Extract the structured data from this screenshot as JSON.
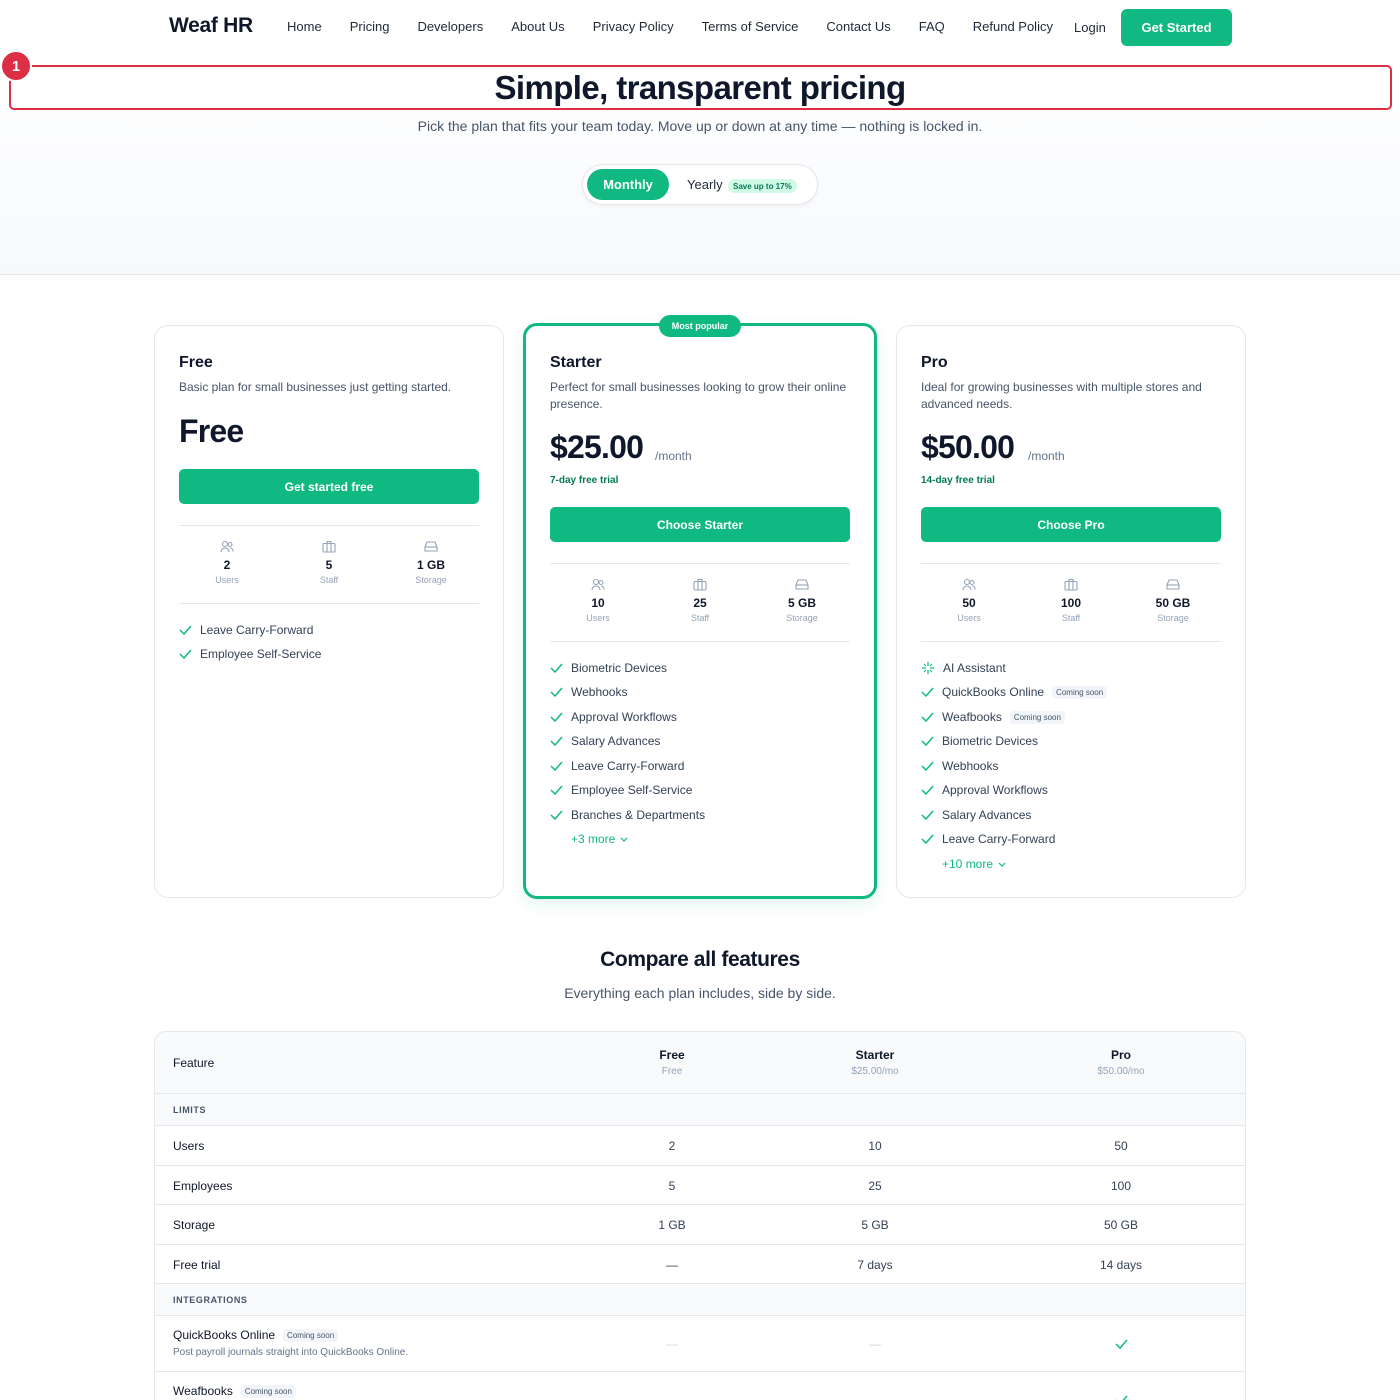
{
  "nav": {
    "logo": "Weaf HR",
    "links": [
      "Home",
      "Pricing",
      "Developers",
      "About Us",
      "Privacy Policy",
      "Terms of Service",
      "Contact Us",
      "FAQ",
      "Refund Policy"
    ],
    "login": "Login",
    "cta": "Get Started"
  },
  "annotation": {
    "badge": "1"
  },
  "hero": {
    "title": "Simple, transparent pricing",
    "subtitle": "Pick the plan that fits your team today. Move up or down at any time — nothing is locked in.",
    "toggle_monthly": "Monthly",
    "toggle_yearly": "Yearly",
    "save_badge": "Save up to 17%"
  },
  "popular_badge": "Most popular",
  "plans": [
    {
      "name": "Free",
      "desc": "Basic plan for small businesses just getting started.",
      "price": "Free",
      "button": "Get started free",
      "stats": [
        {
          "value": "2",
          "label": "Users"
        },
        {
          "value": "5",
          "label": "Staff"
        },
        {
          "value": "1 GB",
          "label": "Storage"
        }
      ],
      "features": [
        "Leave Carry-Forward",
        "Employee Self-Service"
      ]
    },
    {
      "name": "Starter",
      "desc": "Perfect for small businesses looking to grow their online presence.",
      "price": "$25.00",
      "per": "/month",
      "trial": "7-day free trial",
      "button": "Choose Starter",
      "stats": [
        {
          "value": "10",
          "label": "Users"
        },
        {
          "value": "25",
          "label": "Staff"
        },
        {
          "value": "5 GB",
          "label": "Storage"
        }
      ],
      "features": [
        "Biometric Devices",
        "Webhooks",
        "Approval Workflows",
        "Salary Advances",
        "Leave Carry-Forward",
        "Employee Self-Service",
        "Branches & Departments"
      ],
      "more": "+3 more"
    },
    {
      "name": "Pro",
      "desc": "Ideal for growing businesses with multiple stores and advanced needs.",
      "price": "$50.00",
      "per": "/month",
      "trial": "14-day free trial",
      "button": "Choose Pro",
      "stats": [
        {
          "value": "50",
          "label": "Users"
        },
        {
          "value": "100",
          "label": "Staff"
        },
        {
          "value": "50 GB",
          "label": "Storage"
        }
      ],
      "features": [
        "AI Assistant",
        "QuickBooks Online",
        "Weafbooks",
        "Biometric Devices",
        "Webhooks",
        "Approval Workflows",
        "Salary Advances",
        "Leave Carry-Forward"
      ],
      "coming_soon": "Coming soon",
      "more": "+10 more"
    }
  ],
  "compare": {
    "title": "Compare all features",
    "subtitle": "Everything each plan includes, side by side.",
    "header": {
      "feature": "Feature",
      "free_name": "Free",
      "free_price": "Free",
      "starter_name": "Starter",
      "starter_price": "$25.00/mo",
      "pro_name": "Pro",
      "pro_price": "$50.00/mo"
    },
    "section_limits": "LIMITS",
    "section_integrations": "INTEGRATIONS",
    "rows": [
      {
        "name": "Users",
        "free": "2",
        "starter": "10",
        "pro": "50"
      },
      {
        "name": "Employees",
        "free": "5",
        "starter": "25",
        "pro": "100"
      },
      {
        "name": "Storage",
        "free": "1 GB",
        "starter": "5 GB",
        "pro": "50 GB"
      },
      {
        "name": "Free trial",
        "free": "—",
        "starter": "7 days",
        "pro": "14 days"
      }
    ],
    "integrations": [
      {
        "name": "QuickBooks Online",
        "badge": "Coming soon",
        "desc": "Post payroll journals straight into QuickBooks Online.",
        "free": "—",
        "starter": "—"
      },
      {
        "name": "Weafbooks",
        "badge": "Coming soon",
        "free": "—",
        "starter": "—"
      }
    ]
  },
  "colors": {
    "accent": "#10b981",
    "annotation": "#dc2f45"
  }
}
